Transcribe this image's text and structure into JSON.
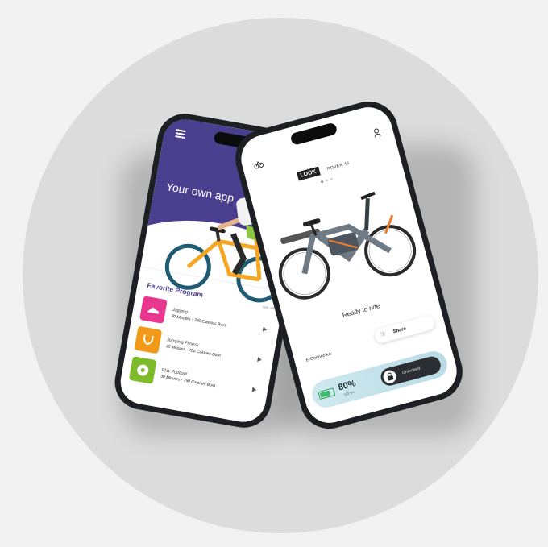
{
  "left_phone": {
    "hero_title": "Your own app",
    "favorites_title": "Favorite Program",
    "see_all": "see all",
    "programs": [
      {
        "name": "Jogging",
        "detail": "30 Minutes - 700 Calories Burn",
        "color": "#e8378f",
        "icon": "shoe-icon"
      },
      {
        "name": "Jumping Fitness",
        "detail": "30 Minutes - 700 Calories Burn",
        "color": "#f19a1a",
        "icon": "jump-rope-icon"
      },
      {
        "name": "Play Football",
        "detail": "30 Minutes - 750 Calories Burn",
        "color": "#7dbb2a",
        "icon": "football-icon"
      }
    ],
    "accent": "#4a3f8f"
  },
  "right_phone": {
    "brand": "LOOK",
    "model": "ROVER 45",
    "carousel_count": 3,
    "status_text": "Ready to ride",
    "connection": "E-Connected",
    "share_label": "Share",
    "battery_percent": "80%",
    "battery_level": 0.8,
    "battery_sub": "122 km",
    "unlock_label": "Unlocked"
  }
}
